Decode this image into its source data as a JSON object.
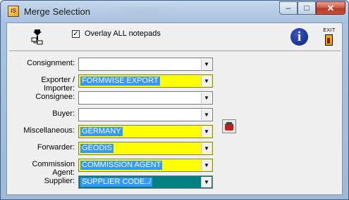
{
  "window": {
    "title": "Merge Selection",
    "app_icon_text": "IS",
    "controls": {
      "minimize": "–",
      "maximize": "□",
      "close": "✕"
    }
  },
  "toolbar": {
    "merge_icon": "merge-icon",
    "overlay_checked": true,
    "overlay_check_mark": "✓",
    "overlay_label": "Overlay ALL notepads",
    "info_icon": "info-icon",
    "info_glyph": "i",
    "exit_label": "EXIT"
  },
  "form": {
    "fields": [
      {
        "label": "Consignment:",
        "value": "",
        "style": "white"
      },
      {
        "label": "Exporter / Importer:",
        "value": "FORMWISE EXPORT",
        "style": "yellow"
      },
      {
        "label": "Consignee:",
        "value": "",
        "style": "white"
      },
      {
        "label": "Buyer:",
        "value": "",
        "style": "white"
      },
      {
        "label": "Miscellaneous:",
        "value": "GERMANY",
        "style": "yellow"
      },
      {
        "label": "Forwarder:",
        "value": "GEODIS",
        "style": "yellow"
      },
      {
        "label": "Commission Agent:",
        "value": "COMMISSION AGENT",
        "style": "yellow"
      },
      {
        "label": "Supplier:",
        "value": "SUPPLIER CODE../",
        "style": "teal"
      }
    ],
    "dropdown_arrow": "▼",
    "misc_side_button": "notepad-icon"
  },
  "colors": {
    "highlight_yellow": "#ffff00",
    "selection_blue": "#3399ff",
    "teal": "#008080",
    "title_gradient_top": "#c5d8ec",
    "close_red": "#c84f35"
  }
}
